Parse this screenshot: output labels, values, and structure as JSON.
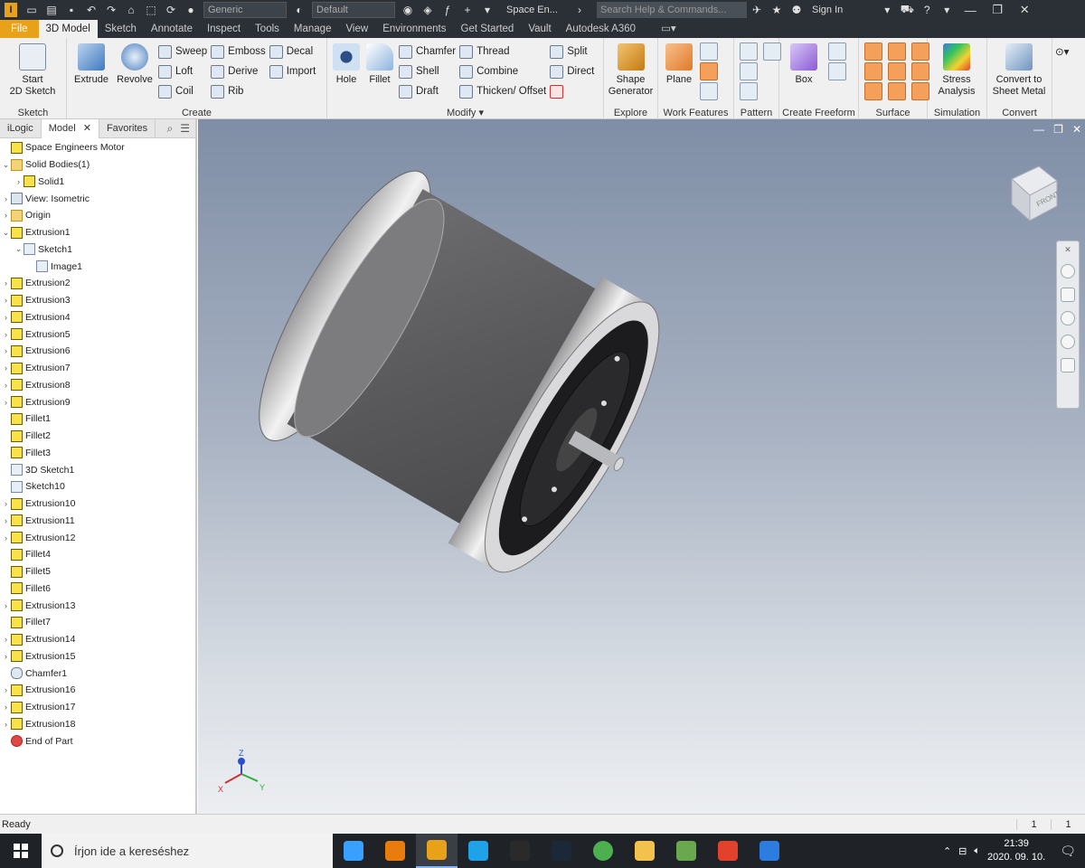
{
  "titlebar": {
    "logo_text": "I",
    "material": "Generic",
    "appearance": "Default",
    "app_title": "Space En...",
    "search_placeholder": "Search Help & Commands...",
    "sign_in": "Sign In",
    "help": "?"
  },
  "tabs": [
    "File",
    "3D Model",
    "Sketch",
    "Annotate",
    "Inspect",
    "Tools",
    "Manage",
    "View",
    "Environments",
    "Get Started",
    "Vault",
    "Autodesk A360"
  ],
  "active_tab": "3D Model",
  "ribbon": {
    "sketch": {
      "title": "Sketch",
      "start_sketch": "Start\n2D Sketch"
    },
    "create": {
      "title": "Create",
      "extrude": "Extrude",
      "revolve": "Revolve",
      "sweep": "Sweep",
      "loft": "Loft",
      "coil": "Coil",
      "emboss": "Emboss",
      "derive": "Derive",
      "rib": "Rib",
      "decal": "Decal",
      "import": "Import"
    },
    "modify": {
      "title": "Modify",
      "hole": "Hole",
      "fillet": "Fillet",
      "chamfer": "Chamfer",
      "shell": "Shell",
      "draft": "Draft",
      "thread": "Thread",
      "combine": "Combine",
      "thicken": "Thicken/ Offset",
      "split": "Split",
      "direct": "Direct"
    },
    "explore": {
      "title": "Explore",
      "shape_generator": "Shape\nGenerator"
    },
    "work_features": {
      "title": "Work Features",
      "plane": "Plane"
    },
    "pattern": {
      "title": "Pattern"
    },
    "freeform": {
      "title": "Create Freeform",
      "box": "Box"
    },
    "surface": {
      "title": "Surface"
    },
    "simulation": {
      "title": "Simulation",
      "stress": "Stress\nAnalysis"
    },
    "convert": {
      "title": "Convert",
      "sheet_metal": "Convert to\nSheet Metal"
    }
  },
  "browser": {
    "tabs": [
      "iLogic",
      "Model",
      "Favorites"
    ],
    "active_tab": "Model",
    "tree": [
      {
        "label": "Space Engineers Motor",
        "indent": 0,
        "arrow": "",
        "icon": "part"
      },
      {
        "label": "Solid Bodies(1)",
        "indent": 0,
        "arrow": "v",
        "icon": "folder"
      },
      {
        "label": "Solid1",
        "indent": 1,
        "arrow": ">",
        "icon": "part"
      },
      {
        "label": "View: Isometric",
        "indent": 0,
        "arrow": ">",
        "icon": "view"
      },
      {
        "label": "Origin",
        "indent": 0,
        "arrow": ">",
        "icon": "folder"
      },
      {
        "label": "Extrusion1",
        "indent": 0,
        "arrow": "v",
        "icon": "part"
      },
      {
        "label": "Sketch1",
        "indent": 1,
        "arrow": "v",
        "icon": "sketch"
      },
      {
        "label": "Image1",
        "indent": 2,
        "arrow": "",
        "icon": "sketch"
      },
      {
        "label": "Extrusion2",
        "indent": 0,
        "arrow": ">",
        "icon": "part"
      },
      {
        "label": "Extrusion3",
        "indent": 0,
        "arrow": ">",
        "icon": "part"
      },
      {
        "label": "Extrusion4",
        "indent": 0,
        "arrow": ">",
        "icon": "part"
      },
      {
        "label": "Extrusion5",
        "indent": 0,
        "arrow": ">",
        "icon": "part"
      },
      {
        "label": "Extrusion6",
        "indent": 0,
        "arrow": ">",
        "icon": "part"
      },
      {
        "label": "Extrusion7",
        "indent": 0,
        "arrow": ">",
        "icon": "part"
      },
      {
        "label": "Extrusion8",
        "indent": 0,
        "arrow": ">",
        "icon": "part"
      },
      {
        "label": "Extrusion9",
        "indent": 0,
        "arrow": ">",
        "icon": "part"
      },
      {
        "label": "Fillet1",
        "indent": 0,
        "arrow": "",
        "icon": "part"
      },
      {
        "label": "Fillet2",
        "indent": 0,
        "arrow": "",
        "icon": "part"
      },
      {
        "label": "Fillet3",
        "indent": 0,
        "arrow": "",
        "icon": "part"
      },
      {
        "label": "3D Sketch1",
        "indent": 0,
        "arrow": "",
        "icon": "sketch"
      },
      {
        "label": "Sketch10",
        "indent": 0,
        "arrow": "",
        "icon": "sketch"
      },
      {
        "label": "Extrusion10",
        "indent": 0,
        "arrow": ">",
        "icon": "part"
      },
      {
        "label": "Extrusion11",
        "indent": 0,
        "arrow": ">",
        "icon": "part"
      },
      {
        "label": "Extrusion12",
        "indent": 0,
        "arrow": ">",
        "icon": "part"
      },
      {
        "label": "Fillet4",
        "indent": 0,
        "arrow": "",
        "icon": "part"
      },
      {
        "label": "Fillet5",
        "indent": 0,
        "arrow": "",
        "icon": "part"
      },
      {
        "label": "Fillet6",
        "indent": 0,
        "arrow": "",
        "icon": "part"
      },
      {
        "label": "Extrusion13",
        "indent": 0,
        "arrow": ">",
        "icon": "part"
      },
      {
        "label": "Fillet7",
        "indent": 0,
        "arrow": "",
        "icon": "part"
      },
      {
        "label": "Extrusion14",
        "indent": 0,
        "arrow": ">",
        "icon": "part"
      },
      {
        "label": "Extrusion15",
        "indent": 0,
        "arrow": ">",
        "icon": "part"
      },
      {
        "label": "Chamfer1",
        "indent": 0,
        "arrow": "",
        "icon": "chamfer"
      },
      {
        "label": "Extrusion16",
        "indent": 0,
        "arrow": ">",
        "icon": "part"
      },
      {
        "label": "Extrusion17",
        "indent": 0,
        "arrow": ">",
        "icon": "part"
      },
      {
        "label": "Extrusion18",
        "indent": 0,
        "arrow": ">",
        "icon": "part"
      },
      {
        "label": "End of Part",
        "indent": 0,
        "arrow": "",
        "icon": "stop"
      }
    ]
  },
  "viewport": {
    "viewcube_label": "FRONT",
    "triad": {
      "x": "X",
      "y": "Y",
      "z": "Z"
    }
  },
  "status": {
    "text": "Ready",
    "count1": "1",
    "count2": "1"
  },
  "taskbar": {
    "search_placeholder": "Írjon ide a kereséshez",
    "apps": [
      "task-view",
      "blender",
      "inventor",
      "ccleaner",
      "epic-games",
      "steam",
      "chrome",
      "file-explorer",
      "minecraft",
      "office",
      "app"
    ],
    "app_colors": [
      "#3aa0ff",
      "#e87d0d",
      "#e8a21a",
      "#1fa2e8",
      "#2a2a2a",
      "#1b2838",
      "#4caf50",
      "#f2c14e",
      "#6aa84f",
      "#e2422b",
      "#2d7de0"
    ],
    "time": "21:39",
    "date": "2020. 09. 10."
  }
}
